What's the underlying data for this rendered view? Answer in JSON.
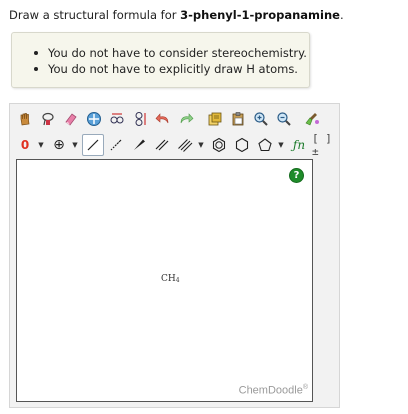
{
  "question": {
    "prefix": "Draw a structural formula for ",
    "compound": "3-phenyl-1-propanamine",
    "suffix": "."
  },
  "hints": [
    "You do not have to consider stereochemistry.",
    "You do not have to explicitly draw H atoms."
  ],
  "toolbar": {
    "row1_icons": [
      "hand-icon",
      "lasso-icon",
      "eraser-icon",
      "center-icon",
      "flip-horizontal-icon",
      "flip-vertical-icon",
      "undo-icon",
      "redo-icon",
      "copy-icon",
      "paste-icon",
      "zoom-in-icon",
      "zoom-out-icon",
      "clean-icon"
    ],
    "charge_label": "0",
    "add_charge_label": "⊕",
    "functions_label": "ƒn",
    "bracket_label": "[ ]±"
  },
  "canvas": {
    "help_label": "?",
    "molecule_label": "CH",
    "molecule_sub": "4",
    "brand": "ChemDoodle",
    "brand_mark": "®"
  },
  "colors": {
    "help_green": "#1f8c2a",
    "charge_red": "#e03020"
  }
}
